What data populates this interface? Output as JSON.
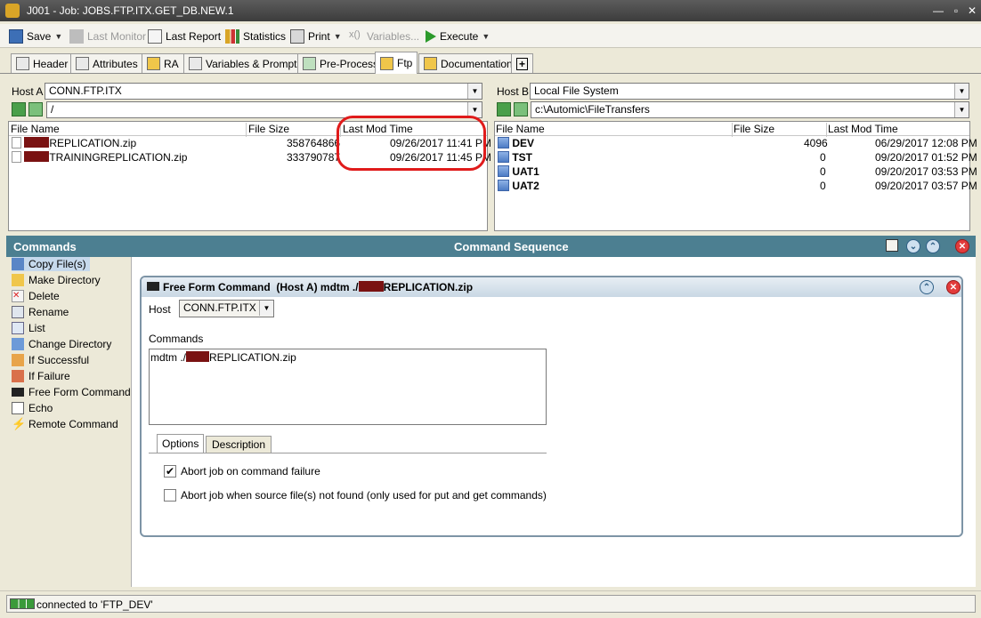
{
  "window": {
    "title": "J001 - Job: JOBS.FTP.ITX.GET_DB.NEW.1",
    "min": "—",
    "max": "▫",
    "close": "✕"
  },
  "toolbar": {
    "save": "Save",
    "last_monitor": "Last Monitor",
    "last_report": "Last Report",
    "statistics": "Statistics",
    "print": "Print",
    "variables": "Variables...",
    "execute": "Execute"
  },
  "tabs": [
    {
      "label": "Header"
    },
    {
      "label": "Attributes"
    },
    {
      "label": "RA"
    },
    {
      "label": "Variables & Prompts"
    },
    {
      "label": "Pre-Process"
    },
    {
      "label": "Ftp"
    },
    {
      "label": "Documentation"
    },
    {
      "label": "+"
    }
  ],
  "host_a": {
    "label": "Host A",
    "value": "CONN.FTP.ITX",
    "path": "/",
    "columns": {
      "name": "File Name",
      "size": "File Size",
      "mtime": "Last Mod Time"
    },
    "files": [
      {
        "name": "REPLICATION.zip",
        "size": "358764866",
        "mtime": "09/26/2017 11:41 PM"
      },
      {
        "name": "TRAININGREPLICATION.zip",
        "size": "333790787",
        "mtime": "09/26/2017 11:45 PM"
      }
    ]
  },
  "host_b": {
    "label": "Host B",
    "value": "Local File System",
    "path": "c:\\Automic\\FileTransfers",
    "columns": {
      "name": "File Name",
      "size": "File Size",
      "mtime": "Last Mod Time"
    },
    "files": [
      {
        "name": "DEV",
        "size": "4096",
        "mtime": "06/29/2017 12:08 PM"
      },
      {
        "name": "TST",
        "size": "0",
        "mtime": "09/20/2017 01:52 PM"
      },
      {
        "name": "UAT1",
        "size": "0",
        "mtime": "09/20/2017 03:53 PM"
      },
      {
        "name": "UAT2",
        "size": "0",
        "mtime": "09/20/2017 03:57 PM"
      }
    ]
  },
  "commands": {
    "header": "Commands",
    "items": [
      {
        "label": "Copy File(s)",
        "icon": "copy-icon"
      },
      {
        "label": "Make Directory",
        "icon": "folder-new-icon"
      },
      {
        "label": "Delete",
        "icon": "delete-icon"
      },
      {
        "label": "Rename",
        "icon": "rename-icon"
      },
      {
        "label": "List",
        "icon": "list-icon"
      },
      {
        "label": "Change Directory",
        "icon": "folder-icon"
      },
      {
        "label": "If Successful",
        "icon": "thumbs-up-icon"
      },
      {
        "label": "If Failure",
        "icon": "thumbs-down-icon"
      },
      {
        "label": "Free Form Command",
        "icon": "terminal-icon"
      },
      {
        "label": "Echo",
        "icon": "echo-icon"
      },
      {
        "label": "Remote Command",
        "icon": "lightning-icon"
      }
    ]
  },
  "sequence": {
    "header": "Command Sequence",
    "command_title_prefix": "Free Form Command  (Host A) mdtm ./",
    "command_title_suffix": "REPLICATION.zip",
    "host_label": "Host",
    "host_value": "CONN.FTP.ITX",
    "commands_label": "Commands",
    "commands_prefix": "mdtm ./",
    "commands_suffix": "REPLICATION.zip",
    "tab_options": "Options",
    "tab_description": "Description",
    "opt1": "Abort job on command failure",
    "opt1_checked": true,
    "opt2": "Abort job when source file(s) not found (only used for put and get commands)",
    "opt2_checked": false
  },
  "status": {
    "text": "connected to 'FTP_DEV'"
  }
}
